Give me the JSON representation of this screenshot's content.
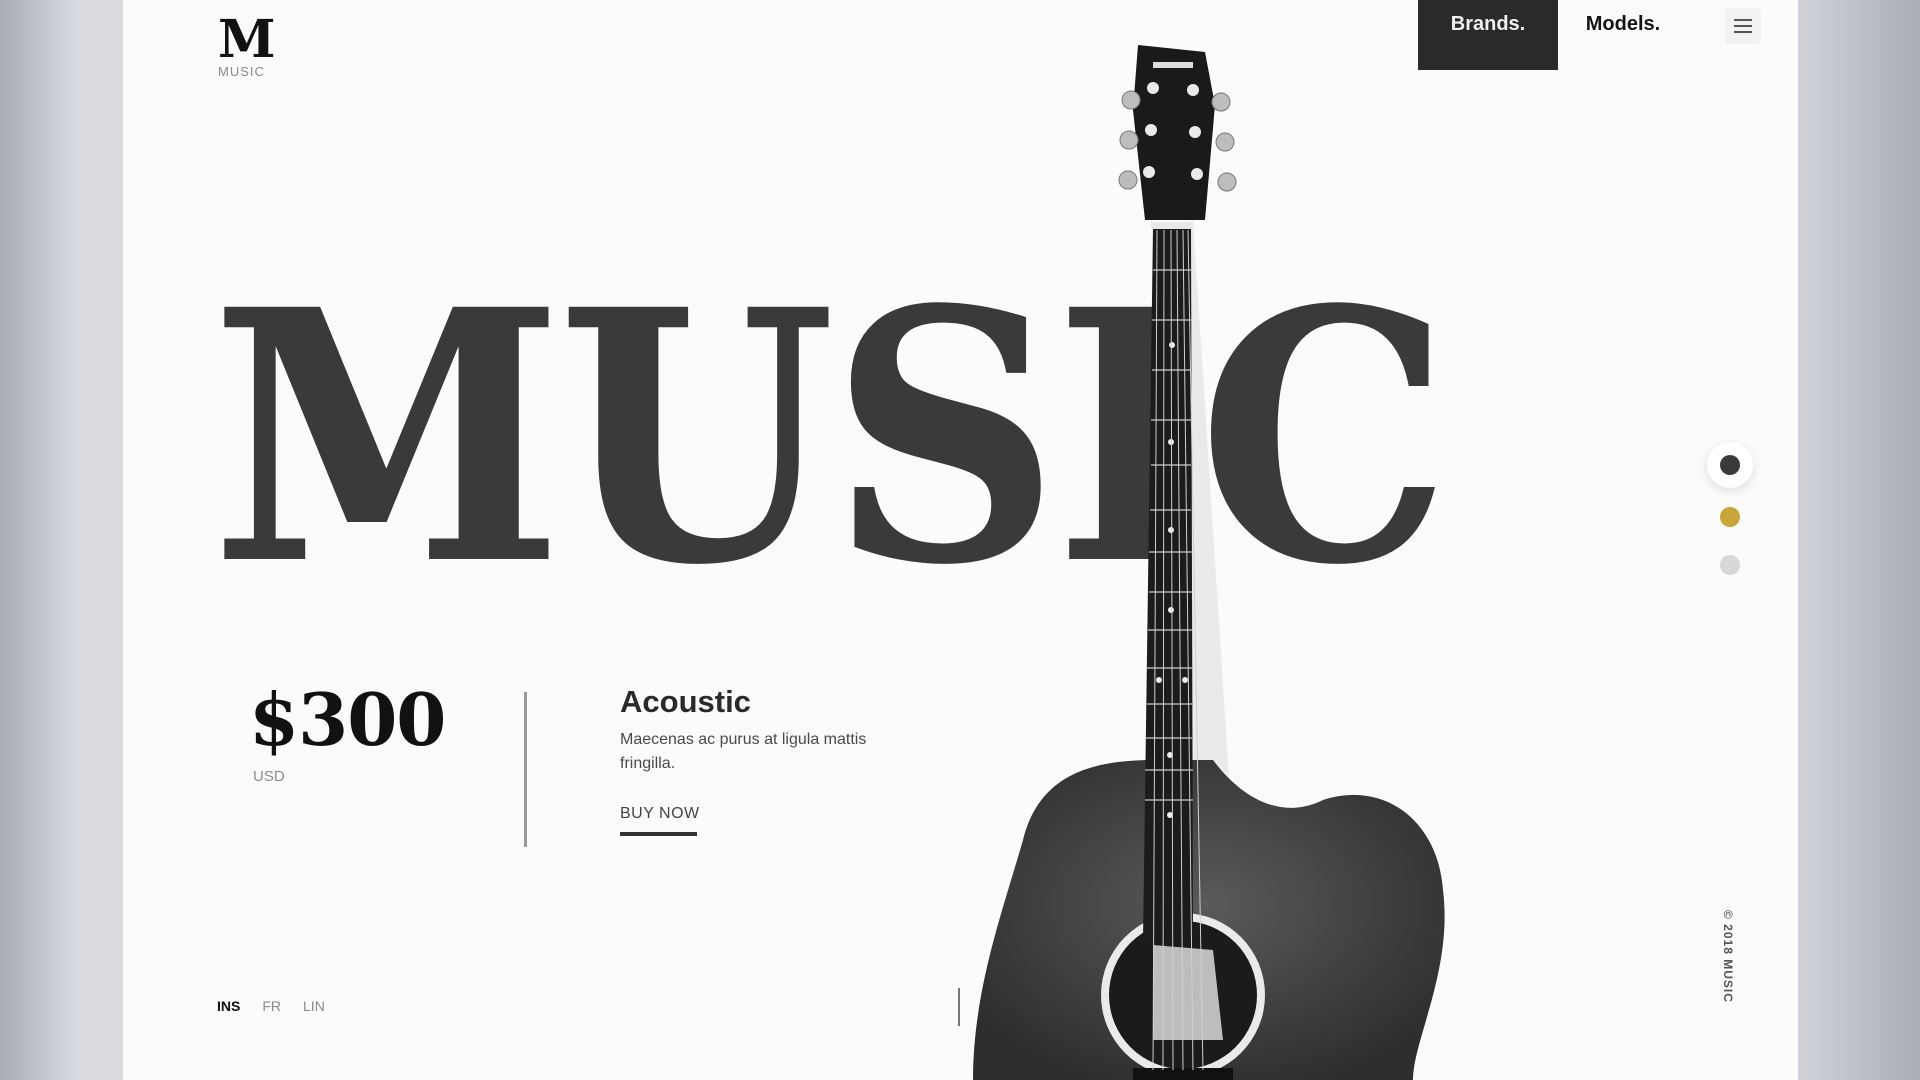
{
  "logo": {
    "mark": "M",
    "sub": "MUSIC"
  },
  "nav": {
    "brands": "Brands.",
    "models": "Models."
  },
  "hero": {
    "word": "MUSIC"
  },
  "product": {
    "price": "$300",
    "currency": "USD",
    "title": "Acoustic",
    "description": "Maecenas ac purus at ligula mattis fringilla.",
    "cta": "BUY NOW"
  },
  "languages": [
    {
      "label": "INS",
      "active": true
    },
    {
      "label": "FR",
      "active": false
    },
    {
      "label": "LIN",
      "active": false
    }
  ],
  "slider": {
    "count": 3,
    "active_index": 0,
    "colors": [
      "#3a3a3a",
      "#caa63a",
      "#d7d7d7"
    ]
  },
  "footer": {
    "copyright": "© 2018 MUSIC"
  },
  "colors": {
    "accent": "#caa63a",
    "dark": "#2a2a2a",
    "background": "#fbfbfb"
  }
}
